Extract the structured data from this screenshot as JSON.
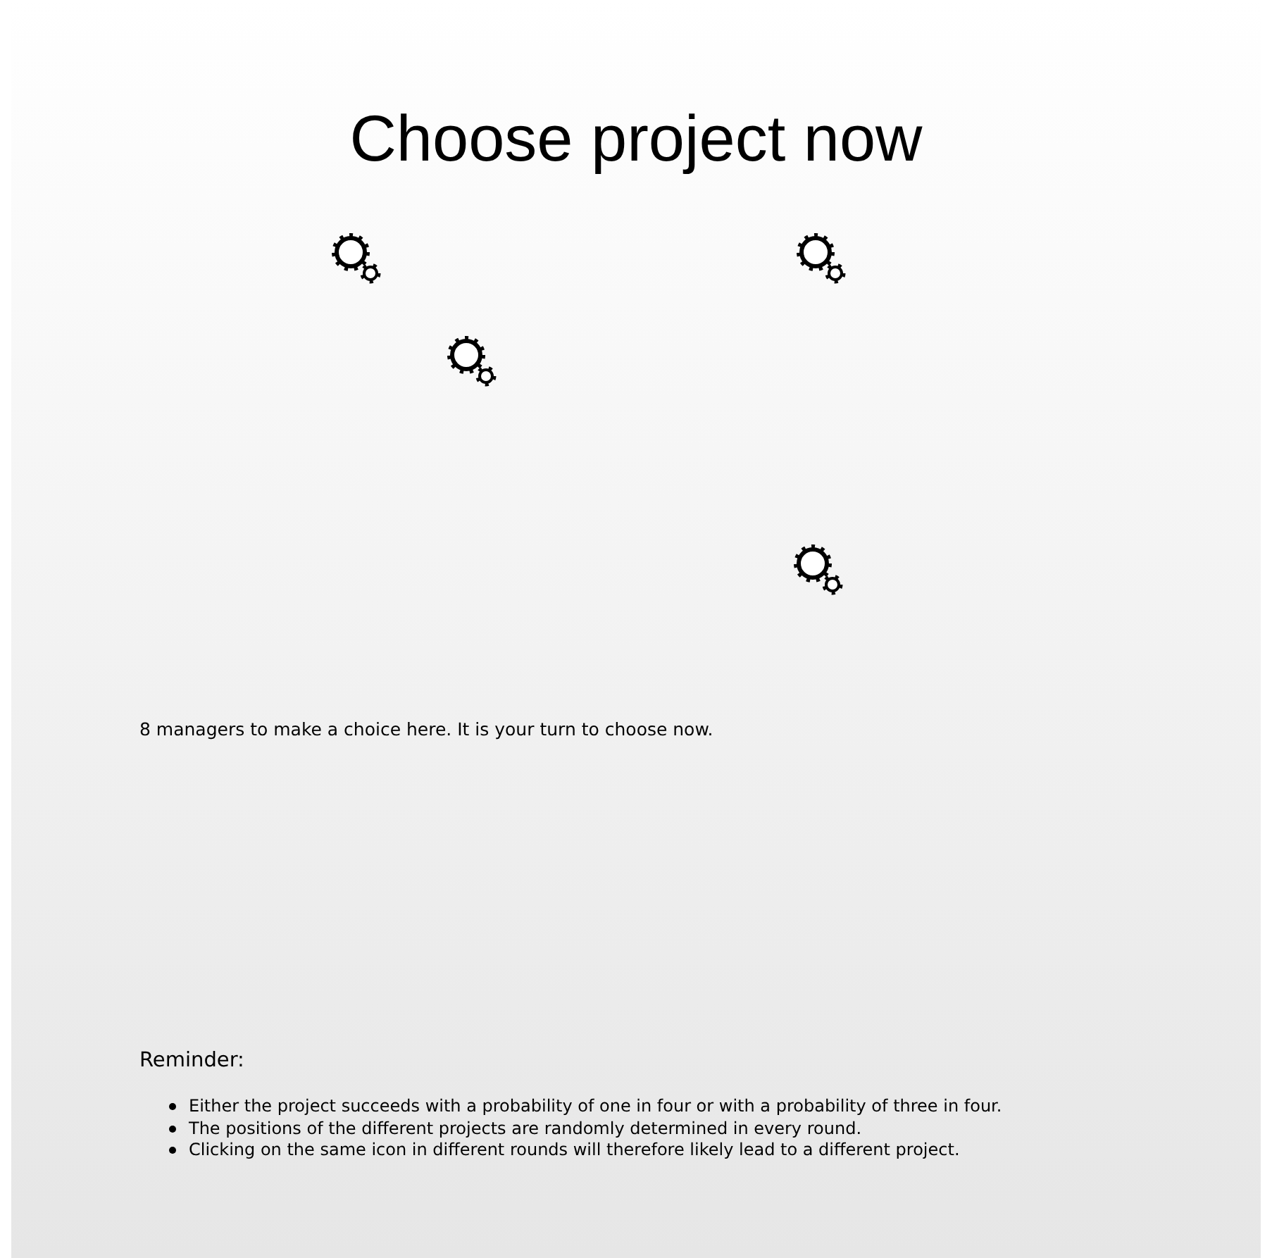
{
  "title": "Choose project now",
  "status_message": "8 managers to make a choice here. It is your turn to choose now.",
  "reminder": {
    "heading": "Reminder:",
    "items": [
      "Either the project succeeds with a probability of one in four or with a probability of three in four.",
      "The positions of the different projects are randomly determined in every round.",
      "Clicking on the same icon in different rounds will therefore likely lead to a different project."
    ]
  }
}
